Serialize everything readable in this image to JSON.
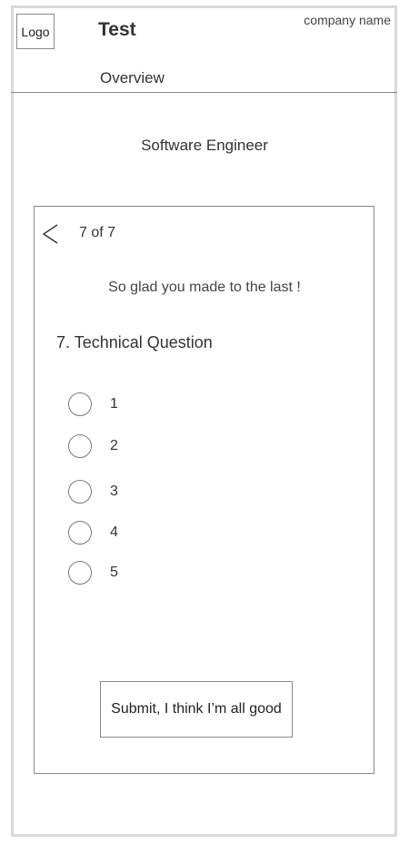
{
  "header": {
    "logo": "Logo",
    "title": "Test",
    "company": "company name"
  },
  "nav": {
    "overview": "Overview"
  },
  "page": {
    "job_title": "Software Engineer"
  },
  "quiz": {
    "progress": "7 of 7",
    "encouragement": "So glad you made to the last !",
    "question": "7. Technical Question",
    "options": [
      "1",
      "2",
      "3",
      "4",
      "5"
    ],
    "submit_label": "Submit, I think I’m all good"
  }
}
